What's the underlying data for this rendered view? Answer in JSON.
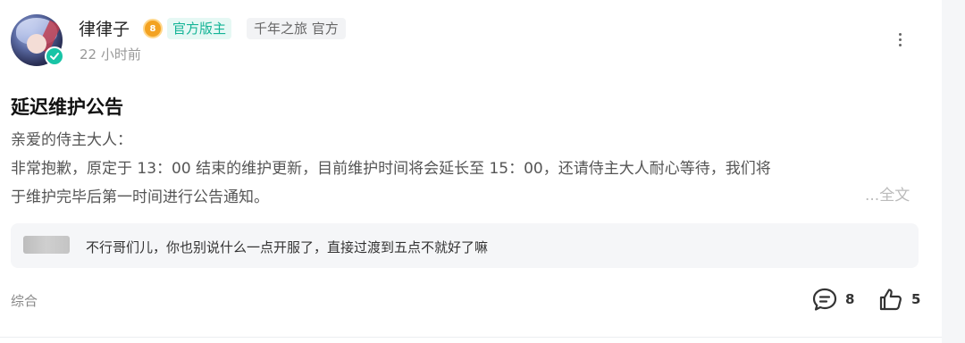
{
  "post": {
    "author": {
      "name": "律律子",
      "level": "8",
      "role_tag": "官方版主",
      "game_tag": "千年之旅 官方"
    },
    "time": "22 小时前",
    "title": "延迟维护公告",
    "body": {
      "line1": "亲爱的侍主大人：",
      "line2": "非常抱歉，原定于 13：00 结束的维护更新，目前维护时间将会延长至 15：00，还请侍主大人耐心等待，我们将",
      "line3": "于维护完毕后第一时间进行公告通知。"
    },
    "full_text_link": "...全文",
    "top_comment": {
      "text": "不行哥们儿，你也别说什么一点开服了，直接过渡到五点不就好了嘛"
    },
    "category": "综合",
    "stats": {
      "comments": "8",
      "likes": "5"
    }
  },
  "icons": {
    "verified": "verified-check-icon",
    "level": "level-badge-icon",
    "more": "more-vertical-icon",
    "comment": "comment-bubble-icon",
    "like": "thumbs-up-icon"
  },
  "colors": {
    "accent": "#18c4a6",
    "role_tag_bg": "#e6f8f4",
    "level_badge": "#f3a221"
  }
}
